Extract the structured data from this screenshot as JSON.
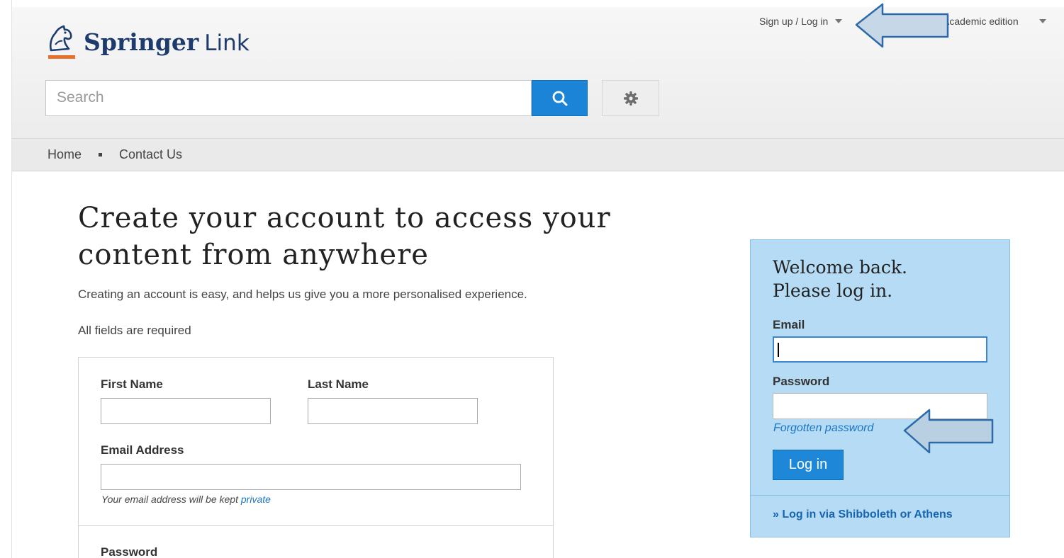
{
  "header": {
    "logo": {
      "brand": "Springer",
      "product": "Link"
    },
    "account_menu_label": "Sign up / Log in",
    "edition_menu_label": "Academic edition",
    "edition_menu_visible_text": "​cademic edition"
  },
  "search": {
    "placeholder": "Search",
    "button_icon": "search-icon",
    "settings_icon": "gear-icon"
  },
  "nav": {
    "items": [
      {
        "label": "Home"
      },
      {
        "label": "Contact Us"
      }
    ]
  },
  "main": {
    "title": "Create your account to access your content from anywhere",
    "intro": "Creating an account is easy, and helps us give you a more personalised experience.",
    "required_note": "All fields are required",
    "form": {
      "first_name_label": "First Name",
      "last_name_label": "Last Name",
      "email_label": "Email Address",
      "email_hint": "Your email address will be kept",
      "email_hint_link": "private",
      "password_label": "Password"
    }
  },
  "login": {
    "title_line1": "Welcome back.",
    "title_line2": "Please log in.",
    "email_label": "Email",
    "password_label": "Password",
    "forgot_link": "Forgotten password",
    "submit_label": "Log in",
    "alt_login_link": "» Log in via Shibboleth or Athens"
  },
  "colors": {
    "brand_navy": "#1d3b6d",
    "accent_blue": "#1b84d6",
    "panel_blue": "#b6dcf5",
    "link_blue": "#1b74c5",
    "logo_orange": "#e8702a"
  }
}
